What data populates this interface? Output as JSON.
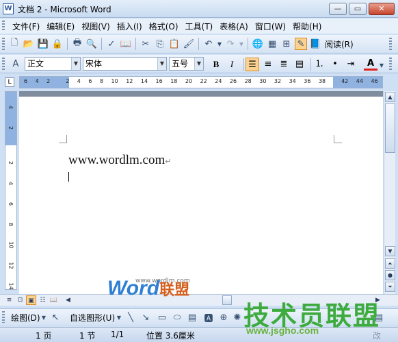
{
  "window": {
    "title": "文档 2 - Microsoft Word",
    "app_icon": "W"
  },
  "menubar": {
    "items": [
      "文件(F)",
      "编辑(E)",
      "视图(V)",
      "插入(I)",
      "格式(O)",
      "工具(T)",
      "表格(A)",
      "窗口(W)",
      "帮助(H)"
    ]
  },
  "toolbar_standard": {
    "read_label": "阅读(R)"
  },
  "toolbar_format": {
    "style": "正文",
    "font": "宋体",
    "size": "五号",
    "bold": "B",
    "italic": "I",
    "font_color_label": "A"
  },
  "ruler": {
    "h_ticks": [
      "6",
      "4",
      "2",
      "",
      "2",
      "4",
      "6",
      "8",
      "10",
      "12",
      "14",
      "16",
      "18",
      "20",
      "22",
      "24",
      "26",
      "28",
      "30",
      "32",
      "34",
      "36",
      "38",
      "",
      "42",
      "44",
      "46"
    ],
    "v_ticks": [
      "4",
      "2",
      "",
      "2",
      "4",
      "6",
      "8",
      "10",
      "12",
      "14"
    ]
  },
  "document": {
    "line1": "www.wordlm.com",
    "paragraph_mark": "↵"
  },
  "drawbar": {
    "draw_label": "绘图(D)",
    "autoshapes_label": "自选图形(U)"
  },
  "status": {
    "page": "1 页",
    "section": "1 节",
    "page_of": "1/1",
    "position": "位置 3.6厘米",
    "mode": "改"
  },
  "watermarks": {
    "logo_word": "Word",
    "logo_cn": "联盟",
    "logo_url": "www.wordlm.com",
    "site_name": "技术员联盟",
    "site_url": "www.jsgho.com"
  }
}
